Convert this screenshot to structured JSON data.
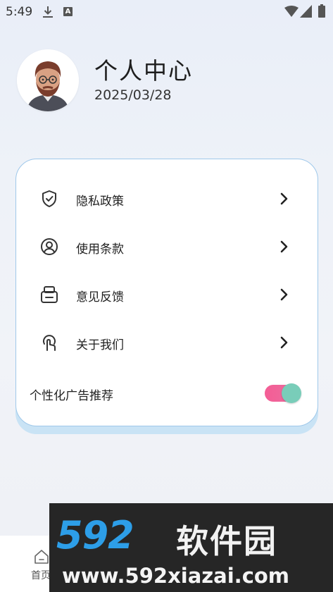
{
  "status_bar": {
    "time": "5:49",
    "badge": "A"
  },
  "profile": {
    "title": "个人中心",
    "date": "2025/03/28"
  },
  "menu": [
    {
      "label": "隐私政策",
      "icon": "shield-check-icon"
    },
    {
      "label": "使用条款",
      "icon": "user-circle-icon"
    },
    {
      "label": "意见反馈",
      "icon": "feedback-box-icon"
    },
    {
      "label": "关于我们",
      "icon": "touch-hand-icon"
    }
  ],
  "ads_setting": {
    "label": "个性化广告推荐",
    "enabled": true
  },
  "tab_bar": {
    "home_label": "首页"
  },
  "watermark": {
    "digits": "592",
    "name": "软件园",
    "url": "www.592xiazai.com"
  },
  "colors": {
    "toggle_track": "#f45d95",
    "toggle_thumb": "#79cdb9",
    "card_border": "#9fc8ea",
    "watermark_blue": "#2d9ee8"
  }
}
